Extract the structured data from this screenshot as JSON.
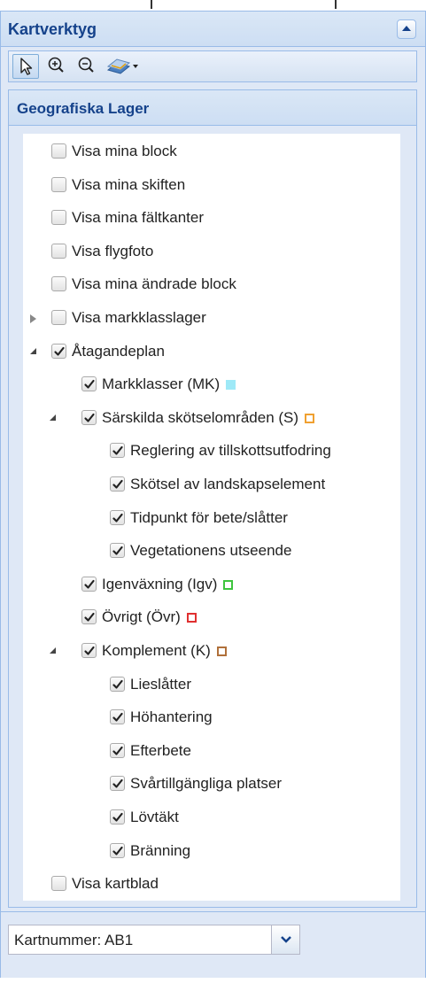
{
  "panel": {
    "title": "Kartverktyg"
  },
  "toolbar": {
    "tools": [
      {
        "name": "pointer-icon",
        "active": true
      },
      {
        "name": "zoom-in-icon",
        "active": false
      },
      {
        "name": "zoom-out-icon",
        "active": false
      },
      {
        "name": "basemap-icon",
        "active": false
      }
    ]
  },
  "layers": {
    "title": "Geografiska Lager",
    "items": [
      {
        "label": "Visa mina block",
        "checked": false,
        "level": 0,
        "expander": "none"
      },
      {
        "label": "Visa mina skiften",
        "checked": false,
        "level": 0,
        "expander": "none"
      },
      {
        "label": "Visa mina fältkanter",
        "checked": false,
        "level": 0,
        "expander": "none"
      },
      {
        "label": "Visa flygfoto",
        "checked": false,
        "level": 0,
        "expander": "none"
      },
      {
        "label": "Visa mina ändrade block",
        "checked": false,
        "level": 0,
        "expander": "none"
      },
      {
        "label": "Visa markklasslager",
        "checked": false,
        "level": 0,
        "expander": "collapsed"
      },
      {
        "label": "Åtagandeplan",
        "checked": true,
        "level": 0,
        "expander": "expanded"
      },
      {
        "label": "Markklasser (MK)",
        "checked": true,
        "level": 1,
        "expander": "none",
        "swatch": {
          "fill": "#9ee9f7",
          "border": "#9ee9f7"
        }
      },
      {
        "label": "Särskilda skötselområden (S)",
        "checked": true,
        "level": 1,
        "expander": "expanded",
        "swatch": {
          "fill": "none",
          "border": "#f0a030"
        }
      },
      {
        "label": "Reglering av tillskottsutfodring",
        "checked": true,
        "level": 2,
        "expander": "none"
      },
      {
        "label": "Skötsel av landskapselement",
        "checked": true,
        "level": 2,
        "expander": "none"
      },
      {
        "label": "Tidpunkt för bete/slåtter",
        "checked": true,
        "level": 2,
        "expander": "none"
      },
      {
        "label": "Vegetationens utseende",
        "checked": true,
        "level": 2,
        "expander": "none"
      },
      {
        "label": "Igenväxning (Igv)",
        "checked": true,
        "level": 1,
        "expander": "none",
        "swatch": {
          "fill": "none",
          "border": "#3ec43e"
        }
      },
      {
        "label": "Övrigt (Övr)",
        "checked": true,
        "level": 1,
        "expander": "none",
        "swatch": {
          "fill": "none",
          "border": "#e03030"
        }
      },
      {
        "label": "Komplement (K)",
        "checked": true,
        "level": 1,
        "expander": "expanded",
        "swatch": {
          "fill": "none",
          "border": "#b0703a"
        }
      },
      {
        "label": "Lieslåtter",
        "checked": true,
        "level": 2,
        "expander": "none"
      },
      {
        "label": "Höhantering",
        "checked": true,
        "level": 2,
        "expander": "none"
      },
      {
        "label": "Efterbete",
        "checked": true,
        "level": 2,
        "expander": "none"
      },
      {
        "label": "Svårtillgängliga platser",
        "checked": true,
        "level": 2,
        "expander": "none"
      },
      {
        "label": "Lövtäkt",
        "checked": true,
        "level": 2,
        "expander": "none"
      },
      {
        "label": "Bränning",
        "checked": true,
        "level": 2,
        "expander": "none"
      },
      {
        "label": "Visa kartblad",
        "checked": false,
        "level": 0,
        "expander": "none"
      }
    ]
  },
  "map_sheet": {
    "selected": "Kartnummer: AB1"
  }
}
